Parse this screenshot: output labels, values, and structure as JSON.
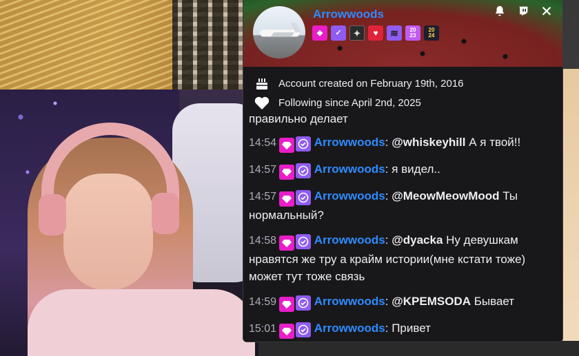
{
  "profile": {
    "username": "Arrowwoods",
    "badges": [
      {
        "name": "gem-badge-icon",
        "glyph": "◆",
        "color": "#e91ec8"
      },
      {
        "name": "verified-badge-icon",
        "glyph": "✓",
        "color": "#8f5cf2"
      },
      {
        "name": "bits-badge-icon",
        "glyph": "✦",
        "color": "#2a2a2a"
      },
      {
        "name": "heart-badge-icon",
        "glyph": "♥",
        "color": "#e0233a"
      },
      {
        "name": "stripe-badge-icon",
        "glyph": "≋",
        "color": "#8f5cf2"
      },
      {
        "name": "year-2023-badge-icon",
        "glyph": "20 23",
        "color": "#c05cf2"
      },
      {
        "name": "year-2024-badge-icon",
        "glyph": "20 24",
        "color": "#1e1e2e"
      }
    ],
    "account_created": "Account created on February 19th, 2016",
    "following_since": "Following since April 2nd, 2025"
  },
  "toolbar": {
    "icons": [
      "notifications-bell-icon",
      "twitch-whisper-icon",
      "close-icon"
    ]
  },
  "chat": {
    "partial_line": "правильно делает",
    "messages": [
      {
        "time": "14:54",
        "user": "Arrowwoods",
        "mention": "@whiskeyhill",
        "text": "А я твой!!"
      },
      {
        "time": "14:57",
        "user": "Arrowwoods",
        "mention": "",
        "text": "я видел.."
      },
      {
        "time": "14:57",
        "user": "Arrowwoods",
        "mention": "@MeowMeowMood",
        "text": "Ты нормальный?"
      },
      {
        "time": "14:58",
        "user": "Arrowwoods",
        "mention": "@dyacka",
        "text": "Ну девушкам нравятся же тру а крайм истории(мне кстати тоже) может тут тоже связь"
      },
      {
        "time": "14:59",
        "user": "Arrowwoods",
        "mention": "@KPEMSODA",
        "text": "Бывает"
      },
      {
        "time": "15:01",
        "user": "Arrowwoods",
        "mention": "",
        "text": "Привет"
      }
    ]
  },
  "colors": {
    "username": "#2e8bff",
    "panel_bg": "#18181b",
    "timestamp": "#adadb8",
    "gem_badge": "#e91ec8",
    "verified_badge": "#8f5cf2"
  }
}
